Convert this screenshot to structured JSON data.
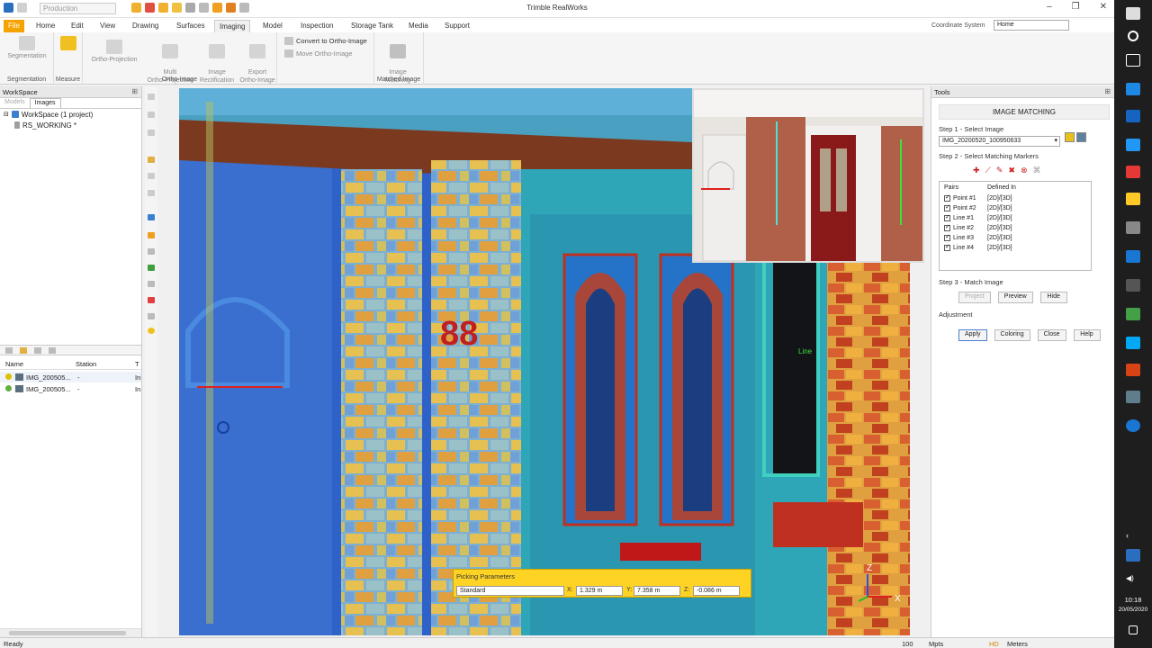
{
  "window": {
    "app_title": "Trimble RealWorks",
    "profile": "Production"
  },
  "menu": {
    "tabs": [
      "File",
      "Home",
      "Edit",
      "View",
      "Drawing",
      "Surfaces",
      "Imaging",
      "Model",
      "Inspection",
      "Storage Tank",
      "Media",
      "Support"
    ],
    "active": "Imaging",
    "coordinate_system_label": "Coordinate System",
    "coordinate_system_value": "Home"
  },
  "ribbon": {
    "segmentation_btn": "Segmentation",
    "measure_btn": "Measure",
    "group1": "Segmentation",
    "group2": "Measure",
    "ortho_projection": "Ortho-Projection",
    "multi_ortho": "Multi\nOrtho-Projection",
    "image_rectification": "Image\nRectification",
    "export_ortho": "Export\nOrtho-Image",
    "convert_ortho": "Convert to Ortho-Image",
    "move_ortho": "Move Ortho-Image",
    "group_ortho": "Ortho-Image",
    "image_matching": "Image\nMatching",
    "group_matched": "Matched Image"
  },
  "workspace": {
    "title": "WorkSpace",
    "tabs": [
      "Models",
      "Images"
    ],
    "project": "WorkSpace (1 project)",
    "node": "RS_WORKING *",
    "columns": [
      "Name",
      "Station",
      "T"
    ],
    "rows": [
      {
        "name": "IMG_200505...",
        "station": "-",
        "t": "In"
      },
      {
        "name": "IMG_200505...",
        "station": "-",
        "t": "In"
      }
    ]
  },
  "tools": {
    "title": "Tools",
    "panel_title": "IMAGE MATCHING",
    "step1": "Step 1 - Select Image",
    "image_value": "IMG_20200520_100950633",
    "step2": "Step 2 - Select Matching Markers",
    "pairs_header": "Pairs",
    "defined_header": "Defined In",
    "pairs": [
      {
        "name": "Point #1",
        "defined": "[2D]/[3D]"
      },
      {
        "name": "Point #2",
        "defined": "[2D]/[3D]"
      },
      {
        "name": "Line #1",
        "defined": "[2D]/[3D]"
      },
      {
        "name": "Line #2",
        "defined": "[2D]/[3D]"
      },
      {
        "name": "Line #3",
        "defined": "[2D]/[3D]"
      },
      {
        "name": "Line #4",
        "defined": "[2D]/[3D]"
      }
    ],
    "step3": "Step 3 - Match Image",
    "project_btn": "Project",
    "preview_btn": "Preview",
    "hide_btn": "Hide",
    "adjustment_label": "Adjustment",
    "apply_btn": "Apply",
    "coloring_btn": "Coloring",
    "close_btn": "Close",
    "help_btn": "Help"
  },
  "picking": {
    "title": "Picking Parameters",
    "mode": "Standard",
    "x_label": "X:",
    "x_value": "1.329 m",
    "y_label": "Y:",
    "y_value": "7.358 m",
    "z_label": "Z:",
    "z_value": "-0.086 m"
  },
  "viewport": {
    "label_line": "Line",
    "axis_z": "Z",
    "axis_x": "X",
    "numbers": "88"
  },
  "status": {
    "ready": "Ready",
    "zoom": "100",
    "mpts": "Mpts",
    "hd": "HD",
    "units": "Meters"
  },
  "taskbar": {
    "time": "10:18",
    "date": "20/05/2020"
  }
}
